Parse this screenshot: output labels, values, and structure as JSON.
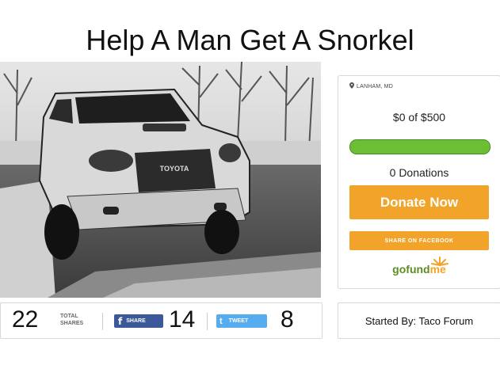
{
  "title": "Help A Man Get A Snorkel",
  "photo": {
    "badge": "TOYOTA"
  },
  "campaign": {
    "location": "LANHAM, MD",
    "goal_text": "$0 of $500",
    "progress": 1.0,
    "donations": "0 Donations",
    "donate_label": "Donate Now",
    "facebook_label": "SHARE ON FACEBOOK",
    "logo_go": "gofund",
    "logo_me": "me"
  },
  "shares": {
    "total": "22",
    "total_label_1": "TOTAL",
    "total_label_2": "SHARES",
    "fb_label": "SHARE",
    "fb_glyph": "f",
    "fb_count": "14",
    "tweet_label": "TWEET",
    "tweet_glyph": "t",
    "tweet_count": "8"
  },
  "started_by": "Started By: Taco Forum",
  "colors": {
    "orange": "#f2a32a",
    "green": "#6cbf34",
    "facebook": "#3b5998",
    "twitter": "#55acee"
  }
}
